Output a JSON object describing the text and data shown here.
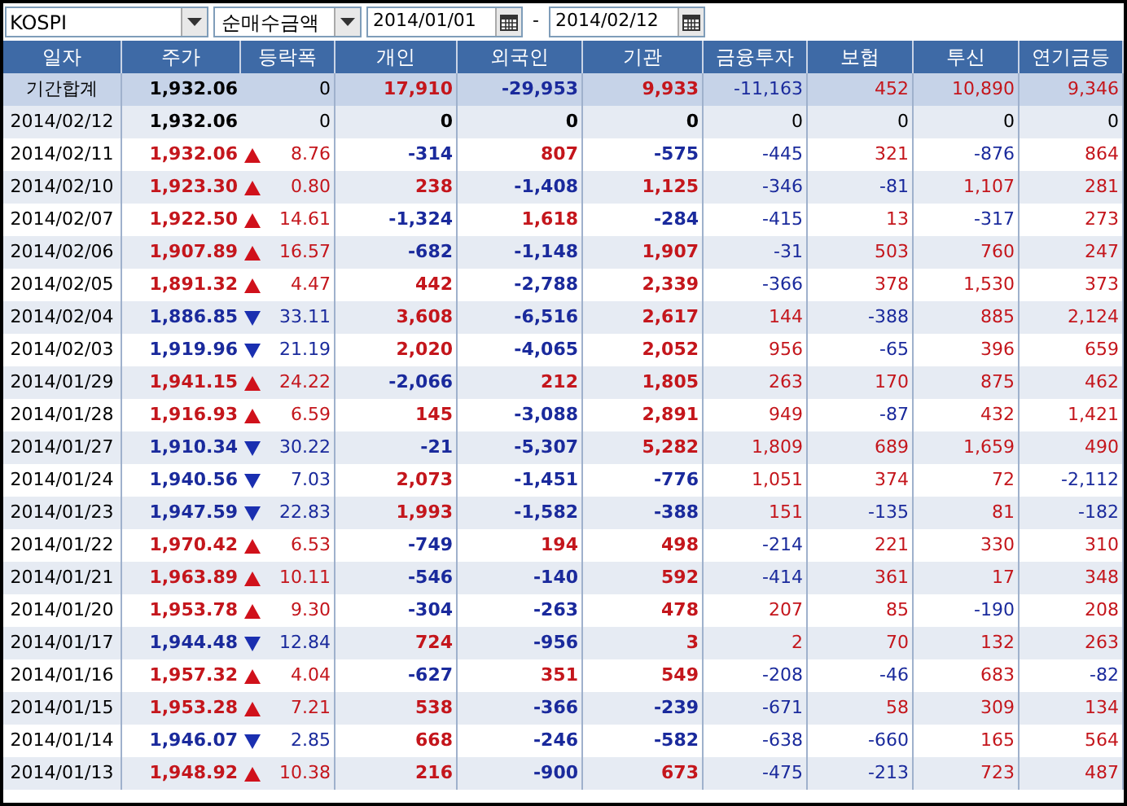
{
  "toolbar": {
    "market": "KOSPI",
    "metric": "순매수금액",
    "date_from": "2014/01/01",
    "separator": "-",
    "date_to": "2014/02/12"
  },
  "table": {
    "columns": [
      "일자",
      "주가",
      "등락폭",
      "개인",
      "외국인",
      "기관",
      "금융투자",
      "보험",
      "투신",
      "연기금등"
    ],
    "rows": [
      {
        "kind": "total",
        "date": "기간합계",
        "price": "1,932.06",
        "up": false,
        "down": false,
        "change": "0",
        "values": [
          "17,910",
          "-29,953",
          "9,933",
          "-11,163",
          "452",
          "10,890",
          "9,346"
        ]
      },
      {
        "kind": "day",
        "date": "2014/02/12",
        "price": "1,932.06",
        "up": false,
        "down": false,
        "change": "0",
        "values": [
          "0",
          "0",
          "0",
          "0",
          "0",
          "0",
          "0"
        ]
      },
      {
        "kind": "day",
        "date": "2014/02/11",
        "price": "1,932.06",
        "up": true,
        "down": false,
        "change": "8.76",
        "values": [
          "-314",
          "807",
          "-575",
          "-445",
          "321",
          "-876",
          "864"
        ]
      },
      {
        "kind": "day",
        "date": "2014/02/10",
        "price": "1,923.30",
        "up": true,
        "down": false,
        "change": "0.80",
        "values": [
          "238",
          "-1,408",
          "1,125",
          "-346",
          "-81",
          "1,107",
          "281"
        ]
      },
      {
        "kind": "day",
        "date": "2014/02/07",
        "price": "1,922.50",
        "up": true,
        "down": false,
        "change": "14.61",
        "values": [
          "-1,324",
          "1,618",
          "-284",
          "-415",
          "13",
          "-317",
          "273"
        ]
      },
      {
        "kind": "day",
        "date": "2014/02/06",
        "price": "1,907.89",
        "up": true,
        "down": false,
        "change": "16.57",
        "values": [
          "-682",
          "-1,148",
          "1,907",
          "-31",
          "503",
          "760",
          "247"
        ]
      },
      {
        "kind": "day",
        "date": "2014/02/05",
        "price": "1,891.32",
        "up": true,
        "down": false,
        "change": "4.47",
        "values": [
          "442",
          "-2,788",
          "2,339",
          "-366",
          "378",
          "1,530",
          "373"
        ]
      },
      {
        "kind": "day",
        "date": "2014/02/04",
        "price": "1,886.85",
        "up": false,
        "down": true,
        "change": "33.11",
        "values": [
          "3,608",
          "-6,516",
          "2,617",
          "144",
          "-388",
          "885",
          "2,124"
        ]
      },
      {
        "kind": "day",
        "date": "2014/02/03",
        "price": "1,919.96",
        "up": false,
        "down": true,
        "change": "21.19",
        "values": [
          "2,020",
          "-4,065",
          "2,052",
          "956",
          "-65",
          "396",
          "659"
        ]
      },
      {
        "kind": "day",
        "date": "2014/01/29",
        "price": "1,941.15",
        "up": true,
        "down": false,
        "change": "24.22",
        "values": [
          "-2,066",
          "212",
          "1,805",
          "263",
          "170",
          "875",
          "462"
        ]
      },
      {
        "kind": "day",
        "date": "2014/01/28",
        "price": "1,916.93",
        "up": true,
        "down": false,
        "change": "6.59",
        "values": [
          "145",
          "-3,088",
          "2,891",
          "949",
          "-87",
          "432",
          "1,421"
        ]
      },
      {
        "kind": "day",
        "date": "2014/01/27",
        "price": "1,910.34",
        "up": false,
        "down": true,
        "change": "30.22",
        "values": [
          "-21",
          "-5,307",
          "5,282",
          "1,809",
          "689",
          "1,659",
          "490"
        ]
      },
      {
        "kind": "day",
        "date": "2014/01/24",
        "price": "1,940.56",
        "up": false,
        "down": true,
        "change": "7.03",
        "values": [
          "2,073",
          "-1,451",
          "-776",
          "1,051",
          "374",
          "72",
          "-2,112"
        ]
      },
      {
        "kind": "day",
        "date": "2014/01/23",
        "price": "1,947.59",
        "up": false,
        "down": true,
        "change": "22.83",
        "values": [
          "1,993",
          "-1,582",
          "-388",
          "151",
          "-135",
          "81",
          "-182"
        ]
      },
      {
        "kind": "day",
        "date": "2014/01/22",
        "price": "1,970.42",
        "up": true,
        "down": false,
        "change": "6.53",
        "values": [
          "-749",
          "194",
          "498",
          "-214",
          "221",
          "330",
          "310"
        ]
      },
      {
        "kind": "day",
        "date": "2014/01/21",
        "price": "1,963.89",
        "up": true,
        "down": false,
        "change": "10.11",
        "values": [
          "-546",
          "-140",
          "592",
          "-414",
          "361",
          "17",
          "348"
        ]
      },
      {
        "kind": "day",
        "date": "2014/01/20",
        "price": "1,953.78",
        "up": true,
        "down": false,
        "change": "9.30",
        "values": [
          "-304",
          "-263",
          "478",
          "207",
          "85",
          "-190",
          "208"
        ]
      },
      {
        "kind": "day",
        "date": "2014/01/17",
        "price": "1,944.48",
        "up": false,
        "down": true,
        "change": "12.84",
        "values": [
          "724",
          "-956",
          "3",
          "2",
          "70",
          "132",
          "263"
        ]
      },
      {
        "kind": "day",
        "date": "2014/01/16",
        "price": "1,957.32",
        "up": true,
        "down": false,
        "change": "4.04",
        "values": [
          "-627",
          "351",
          "549",
          "-208",
          "-46",
          "683",
          "-82"
        ]
      },
      {
        "kind": "day",
        "date": "2014/01/15",
        "price": "1,953.28",
        "up": true,
        "down": false,
        "change": "7.21",
        "values": [
          "538",
          "-366",
          "-239",
          "-671",
          "58",
          "309",
          "134"
        ]
      },
      {
        "kind": "day",
        "date": "2014/01/14",
        "price": "1,946.07",
        "up": false,
        "down": true,
        "change": "2.85",
        "values": [
          "668",
          "-246",
          "-582",
          "-638",
          "-660",
          "165",
          "564"
        ]
      },
      {
        "kind": "day",
        "date": "2014/01/13",
        "price": "1,948.92",
        "up": true,
        "down": false,
        "change": "10.38",
        "values": [
          "216",
          "-900",
          "673",
          "-475",
          "-213",
          "723",
          "487"
        ]
      }
    ]
  }
}
